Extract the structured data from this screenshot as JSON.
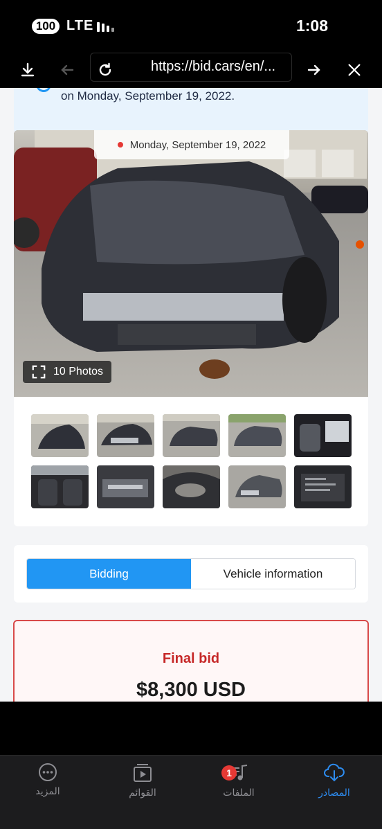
{
  "status_bar": {
    "battery": "100",
    "network": "LTE",
    "time": "1:08"
  },
  "browser": {
    "url": "https://bid.cars/en/..."
  },
  "page": {
    "date_banner": "on Monday, September 19, 2022.",
    "photo_date": "Monday, September 19, 2022",
    "photo_count": "10 Photos",
    "thumbnail_count": 10,
    "tabs": [
      {
        "label": "Bidding",
        "active": true
      },
      {
        "label": "Vehicle information",
        "active": false
      }
    ],
    "final_bid_label": "Final bid",
    "final_bid_value": "$8,300 USD"
  },
  "bottom_nav": {
    "items": [
      {
        "label": "المزيد",
        "icon": "more-icon"
      },
      {
        "label": "القوائم",
        "icon": "playlist-icon"
      },
      {
        "label": "الملفات",
        "icon": "music-files-icon",
        "badge": "1"
      },
      {
        "label": "المصادر",
        "icon": "cloud-download-icon",
        "active": true
      }
    ]
  },
  "colors": {
    "accent": "#2196f3",
    "bid_red": "#c62828",
    "nav_active": "#2d8cf0"
  }
}
